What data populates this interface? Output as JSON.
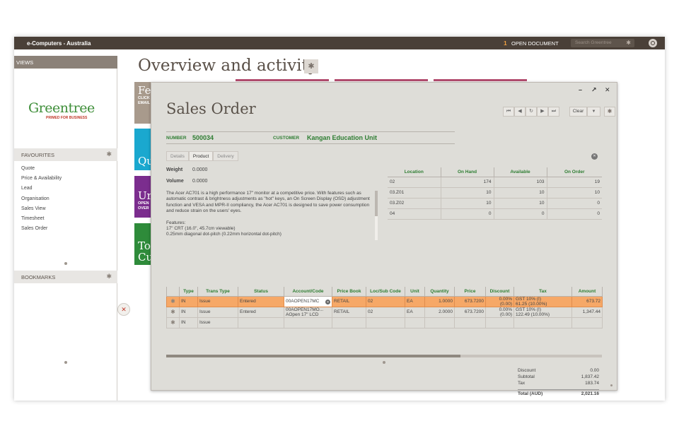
{
  "topbar": {
    "app_title": "e-Computers - Australia",
    "open_doc_count": "1",
    "open_doc_label": "OPEN DOCUMENT",
    "search_placeholder": "Search Greentree"
  },
  "sidebar": {
    "views_label": "VIEWS",
    "logo_text": "Greentree",
    "logo_tagline": "PRIMED FOR BUSINESS",
    "favourites_label": "FAVOURITES",
    "favourites": [
      "Quote",
      "Price & Availability",
      "Lead",
      "Organisation",
      "Sales View",
      "Timesheet",
      "Sales Order"
    ],
    "bookmarks_label": "BOOKMARKS"
  },
  "main": {
    "title": "Overview and activity",
    "tiles": [
      {
        "big": "Fe",
        "small1": "CLICK",
        "small2": "EMAIL",
        "color": "#a89a8c"
      },
      {
        "big": "Qu",
        "small1": "",
        "small2": "",
        "color": "#1aa8cf"
      },
      {
        "big": "Ur",
        "small1": "OPEN",
        "small2": "OVER",
        "color": "#7b2d8e"
      },
      {
        "big": "To",
        "big2": "Cu",
        "color": "#2e8b3a"
      }
    ]
  },
  "sales_order": {
    "title": "Sales Order",
    "clear_label": "Clear",
    "number_label": "NUMBER",
    "number": "500034",
    "customer_label": "CUSTOMER",
    "customer": "Kangan Education Unit",
    "tabs": [
      "Details",
      "Product",
      "Delivery"
    ],
    "weight_label": "Weight",
    "weight": "0.0000",
    "volume_label": "Volume",
    "volume": "0.0000",
    "description": [
      "The Acer AC701 is a high performance 17\" monitor at a competitive price. With features such as automatic contrast & brightness adjustments as \"hot\" keys, an On Screen Display (OSD) adjustment function and VESA and MPR-II compliancy, the Acer AC701 is designed to save power consumption and reduce strain on the users' eyes.",
      "",
      "Features:",
      "17\" CRT (16.0\", 45.7cm viewable)",
      "0.25mm diagonal dot-pitch (0.22mm horizontal dot-pitch)"
    ],
    "stock": {
      "headers": [
        "Location",
        "On Hand",
        "Available",
        "On Order"
      ],
      "rows": [
        [
          "02",
          "174",
          "103",
          "19"
        ],
        [
          "03.Z01",
          "10",
          "10",
          "10"
        ],
        [
          "03.Z02",
          "10",
          "10",
          "0"
        ],
        [
          "04",
          "0",
          "0",
          "0"
        ]
      ]
    },
    "lines": {
      "headers": [
        "",
        "Type",
        "Trans Type",
        "Status",
        "Account/Code",
        "Price Book",
        "Loc/Sub Code",
        "Unit",
        "Quantity",
        "Price",
        "Discount",
        "Tax",
        "Amount"
      ],
      "rows": [
        {
          "type": "IN",
          "trans": "Issue",
          "status": "Entered",
          "acct1": "00AOPEN17MC",
          "acct2": "",
          "book": "RETAIL",
          "loc": "02",
          "unit": "EA",
          "qty": "1.0000",
          "price": "673.7200",
          "disc1": "0.00%",
          "disc2": "(0.00)",
          "tax1": "GST 10% (I)",
          "tax2": "61.25 (10.00%)",
          "amount": "673.72"
        },
        {
          "type": "IN",
          "trans": "Issue",
          "status": "Entered",
          "acct1": "00AOPEN17MO...",
          "acct2": "AOpen 17\" LCD",
          "book": "RETAIL",
          "loc": "02",
          "unit": "EA",
          "qty": "2.0000",
          "price": "673.7200",
          "disc1": "0.00%",
          "disc2": "(0.00)",
          "tax1": "GST 10% (I)",
          "tax2": "122.49 (10.00%)",
          "amount": "1,347.44"
        },
        {
          "type": "IN",
          "trans": "Issue",
          "status": "",
          "acct1": "",
          "acct2": "",
          "book": "",
          "loc": "",
          "unit": "",
          "qty": "",
          "price": "",
          "disc1": "",
          "disc2": "",
          "tax1": "",
          "tax2": "",
          "amount": ""
        }
      ]
    },
    "totals": [
      {
        "label": "Discount",
        "value": "0.00"
      },
      {
        "label": "Subtotal",
        "value": "1,837.42"
      },
      {
        "label": "Tax",
        "value": "183.74"
      }
    ],
    "total_label": "Total (AUD)",
    "total_value": "2,021.16"
  }
}
